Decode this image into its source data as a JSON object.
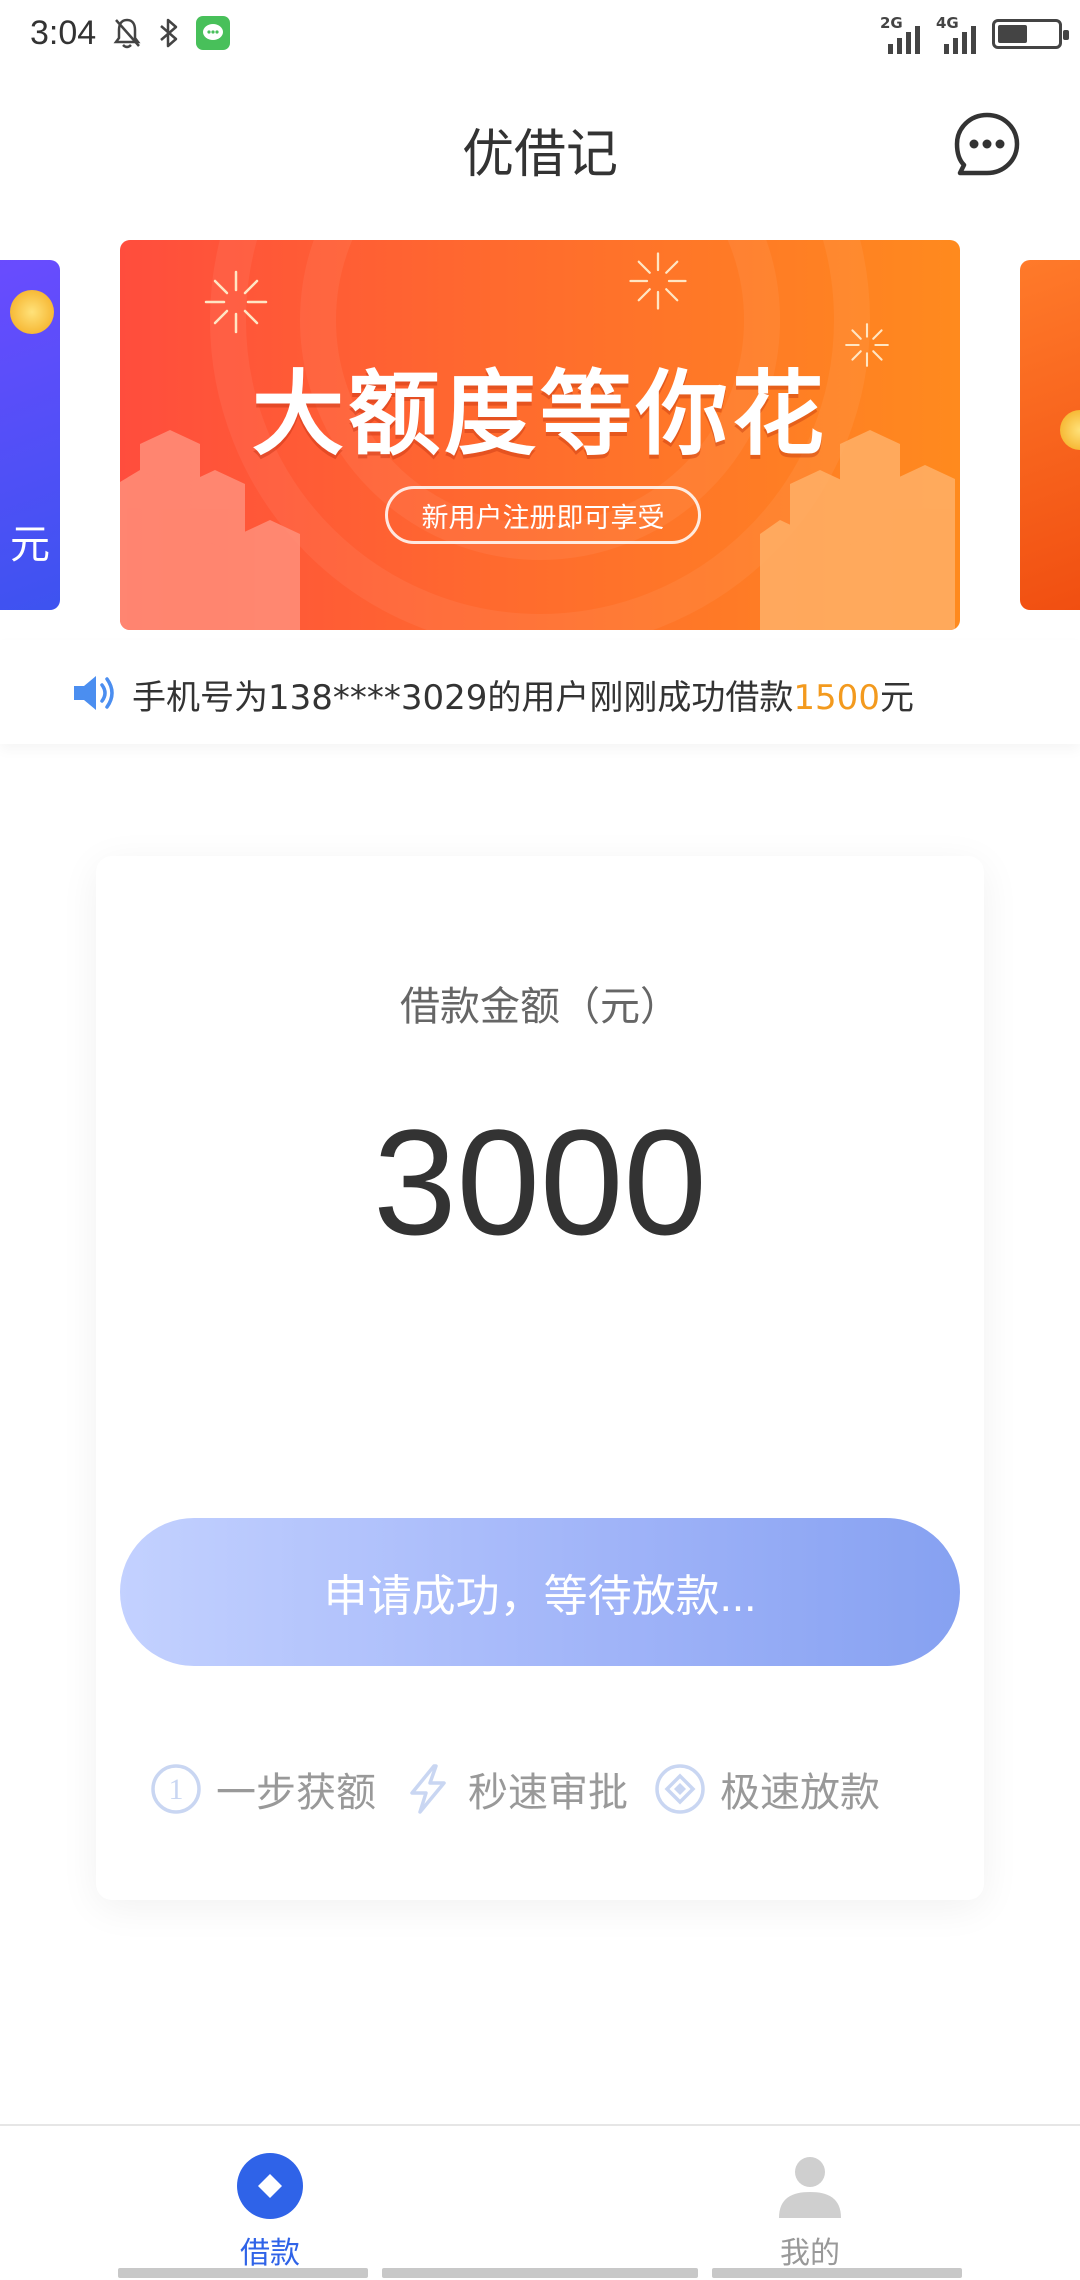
{
  "status_bar": {
    "time": "3:04",
    "network_1": "2G",
    "network_2": "4G"
  },
  "header": {
    "title": "优借记"
  },
  "banner": {
    "title": "大额度等你花",
    "subtitle": "新用户注册即可享受",
    "left_slide_char": "元"
  },
  "notice": {
    "text_prefix": "手机号为138****3029的用户刚刚成功借款",
    "amount": "1500",
    "text_suffix": "元"
  },
  "loan_card": {
    "amount_label": "借款金额（元）",
    "amount_value": "3000",
    "status_button_label": "申请成功，等待放款...",
    "features": [
      {
        "label": "一步获额",
        "icon": "number-one-circle-icon"
      },
      {
        "label": "秒速审批",
        "icon": "lightning-icon"
      },
      {
        "label": "极速放款",
        "icon": "diamond-circle-icon"
      }
    ]
  },
  "bottom_nav": {
    "loan_label": "借款",
    "mine_label": "我的",
    "active": "loan"
  },
  "colors": {
    "accent": "#2f63e8",
    "notice_amount": "#f39a1e",
    "banner_start": "#ff4d3d",
    "banner_end": "#ff8a1e"
  }
}
